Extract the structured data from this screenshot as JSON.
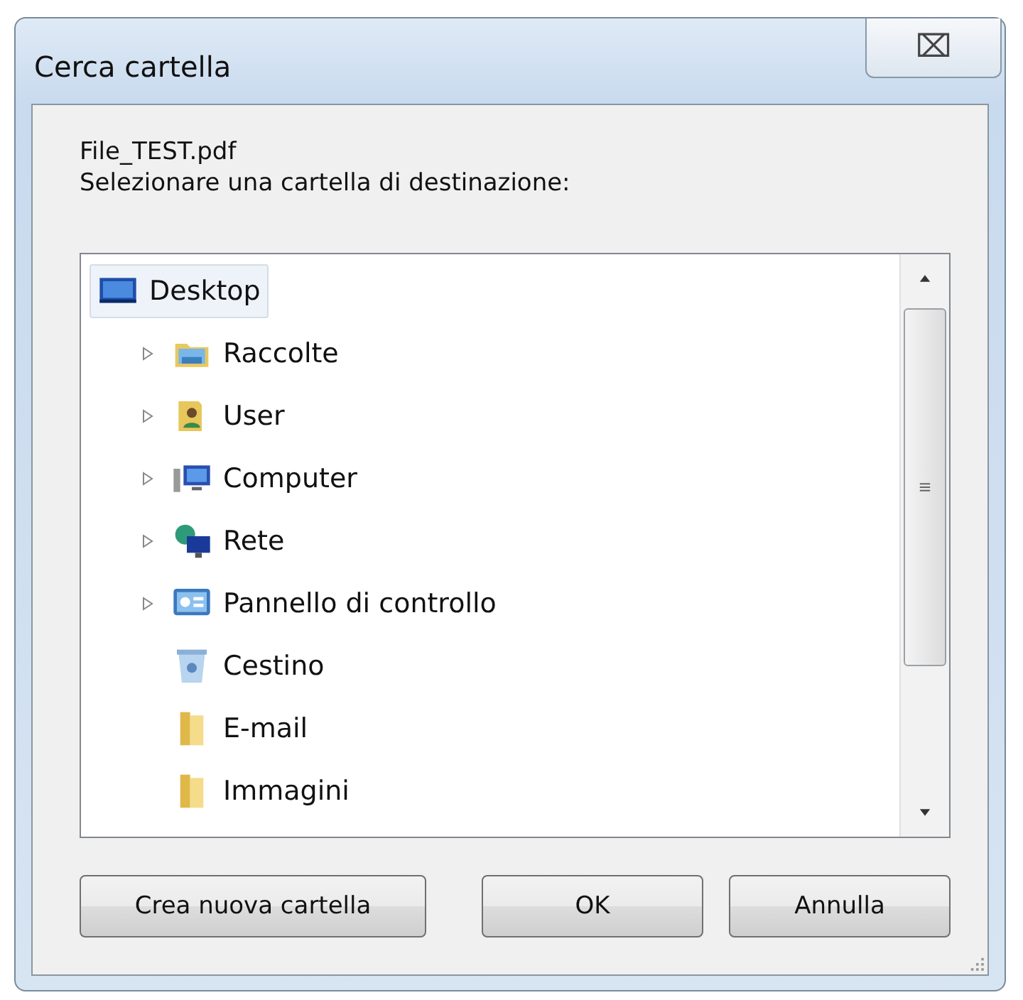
{
  "window": {
    "title": "Cerca cartella",
    "close_label": "⌧"
  },
  "message": {
    "file": "File_TEST.pdf",
    "prompt": "Selezionare una cartella di destinazione:"
  },
  "tree": [
    {
      "label": "Desktop",
      "kind": "desktop",
      "selected": true,
      "children": [
        {
          "label": "Raccolte",
          "kind": "library",
          "expandable": true,
          "selected": false
        },
        {
          "label": "User",
          "kind": "user",
          "expandable": true,
          "selected": false
        },
        {
          "label": "Computer",
          "kind": "computer",
          "expandable": true,
          "selected": false
        },
        {
          "label": "Rete",
          "kind": "network",
          "expandable": true,
          "selected": false
        },
        {
          "label": "Pannello di controllo",
          "kind": "control-panel",
          "expandable": true,
          "selected": false
        },
        {
          "label": "Cestino",
          "kind": "recycle-bin",
          "expandable": false,
          "selected": false
        },
        {
          "label": "E-mail",
          "kind": "folder",
          "expandable": false,
          "selected": false
        },
        {
          "label": "Immagini",
          "kind": "folder",
          "expandable": false,
          "selected": false
        }
      ]
    }
  ],
  "buttons": [
    {
      "label": "Crea nuova cartella",
      "kind": "left"
    },
    {
      "label": "OK",
      "kind": "right"
    },
    {
      "label": "Annulla",
      "kind": "right"
    }
  ]
}
